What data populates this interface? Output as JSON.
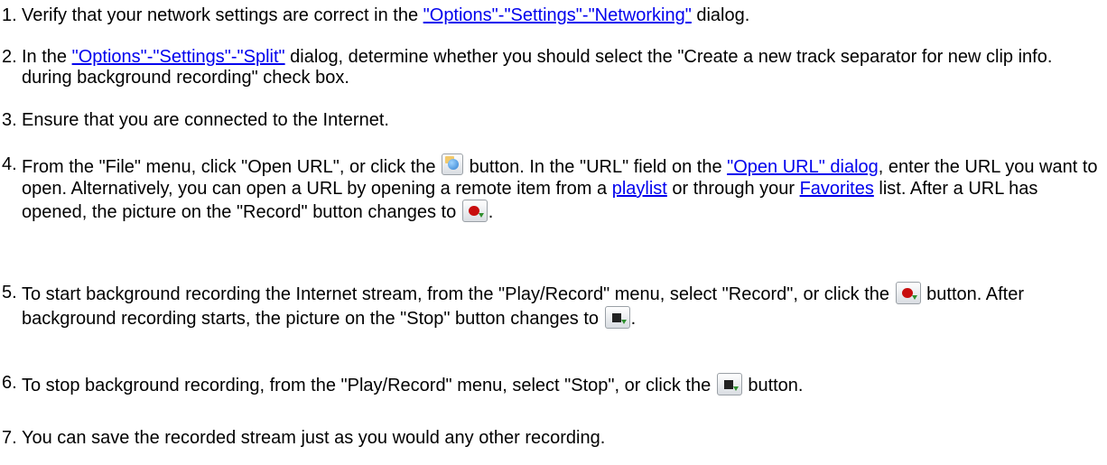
{
  "steps": [
    {
      "num": "1.",
      "pre": "Verify that your network settings are correct in the ",
      "link": "\"Options\"-\"Settings\"-\"Networking\"",
      "post": " dialog."
    },
    {
      "num": "2.",
      "pre": "In the ",
      "link": "\"Options\"-\"Settings\"-\"Split\"",
      "post": " dialog, determine whether you should select the \"Create a new track separator for new clip info. during background recording\" check box."
    },
    {
      "num": "3.",
      "text": "Ensure that you are connected to the Internet."
    },
    {
      "num": "4.",
      "t1": "From the \"File\" menu, click \"Open URL\", or click the ",
      "t2": " button. In the \"URL\" field on the ",
      "link1": "\"Open URL\" dialog",
      "t3": ", enter the URL you want to open. Alternatively, you can open a URL by opening a remote item from a ",
      "link2": "playlist",
      "t4": " or through your ",
      "link3": "Favorites",
      "t5": " list. After a URL has opened, the picture on the \"Record\" button changes to ",
      "t6": "."
    },
    {
      "num": "5.",
      "t1": "To start background recording the Internet stream, from the \"Play/Record\" menu, select \"Record\", or click the ",
      "t2": " button. After background recording starts, the picture on the \"Stop\" button changes to ",
      "t3": "."
    },
    {
      "num": "6.",
      "t1": "To stop background recording, from the \"Play/Record\" menu, select \"Stop\", or click the ",
      "t2": " button."
    },
    {
      "num": "7.",
      "text": "You can save the recorded stream just as you would any other recording."
    }
  ],
  "icons": {
    "open_url": "open-url-icon",
    "record": "record-icon",
    "stop": "stop-recording-icon"
  },
  "colors": {
    "link": "#0000ee",
    "record_dot": "#c80d0d"
  }
}
